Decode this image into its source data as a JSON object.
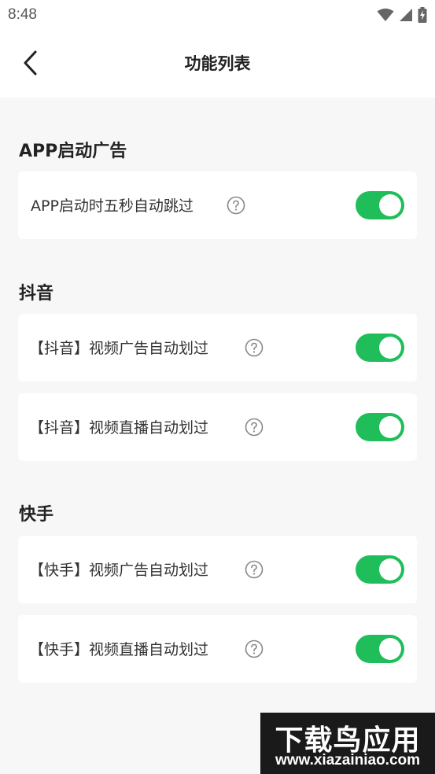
{
  "status_bar": {
    "time": "8:48",
    "icons": [
      "wifi-icon",
      "signal-icon",
      "battery-charging-icon"
    ]
  },
  "header": {
    "title": "功能列表",
    "back_icon": "chevron-left-icon"
  },
  "sections": [
    {
      "title": "APP启动广告",
      "items": [
        {
          "label": "APP启动时五秒自动跳过",
          "enabled": true
        }
      ]
    },
    {
      "title": "抖音",
      "items": [
        {
          "label": "【抖音】视频广告自动划过",
          "enabled": true
        },
        {
          "label": "【抖音】视频直播自动划过",
          "enabled": true
        }
      ]
    },
    {
      "title": "快手",
      "items": [
        {
          "label": "【快手】视频广告自动划过",
          "enabled": true
        },
        {
          "label": "【快手】视频直播自动划过",
          "enabled": true
        }
      ]
    }
  ],
  "colors": {
    "toggle_on": "#1fbe5a",
    "background": "#f7f7f7",
    "card": "#ffffff"
  },
  "watermark": {
    "title": "下载鸟应用",
    "url": "www.xiazainiao.com"
  }
}
